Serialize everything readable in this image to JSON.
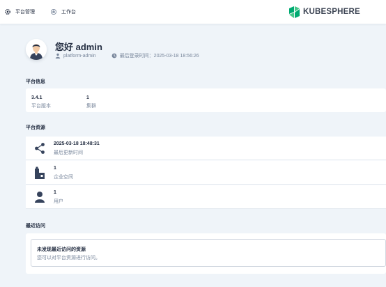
{
  "topnav": {
    "platform_label": "平台管理",
    "workbench_label": "工作台",
    "logo_text": "KUBESPHERE",
    "brand_color": "#00aa72"
  },
  "banner": {
    "greeting": "您好 admin",
    "role": "platform-admin",
    "last_login": "最后登录时间：2025-03-18 18:56:26"
  },
  "platform_info": {
    "title": "平台信息",
    "stats": [
      {
        "value": "3.4.1",
        "label": "平台版本"
      },
      {
        "value": "1",
        "label": "集群"
      }
    ]
  },
  "platform_resources": {
    "title": "平台资源",
    "items": [
      {
        "icon": "share-nodes-icon",
        "value": "2025-03-18 18:48:31",
        "label": "最后更新时间"
      },
      {
        "icon": "enterprise-space-icon",
        "value": "1",
        "label": "企业空间"
      },
      {
        "icon": "user-icon",
        "value": "1",
        "label": "用户"
      }
    ]
  },
  "recent": {
    "title": "最近访问",
    "empty_title": "未发现最近访问的资源",
    "empty_desc": "您可以对平台资源进行访问。"
  }
}
